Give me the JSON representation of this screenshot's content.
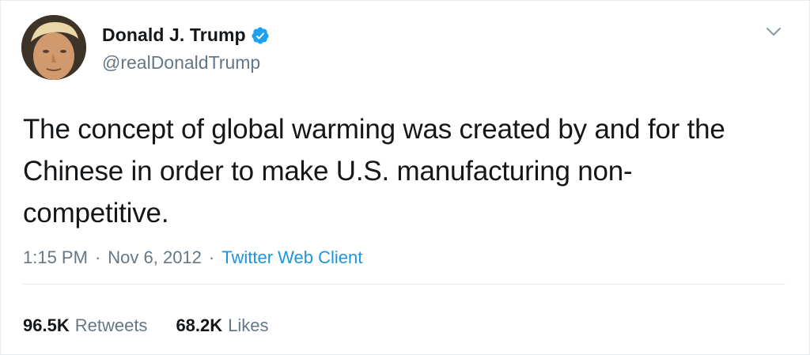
{
  "author": {
    "display_name": "Donald J. Trump",
    "handle": "@realDonaldTrump",
    "verified": true,
    "avatar": "profile-photo"
  },
  "tweet": {
    "text_lines": [
      "The concept of global warming was created by and for the",
      "Chinese in order to make U.S. manufacturing non-",
      "competitive."
    ],
    "time": "1:15 PM",
    "separator": "·",
    "date": "Nov 6, 2012",
    "client": "Twitter Web Client"
  },
  "stats": {
    "retweets_count": "96.5K",
    "retweets_label": "Retweets",
    "likes_count": "68.2K",
    "likes_label": "Likes"
  },
  "icons": {
    "verified": "verified-badge-icon",
    "menu": "chevron-down-icon"
  },
  "colors": {
    "text": "#14171a",
    "secondary": "#657786",
    "link": "#1b95e0",
    "verified": "#1da1f2",
    "divider": "#e6ecf0"
  }
}
